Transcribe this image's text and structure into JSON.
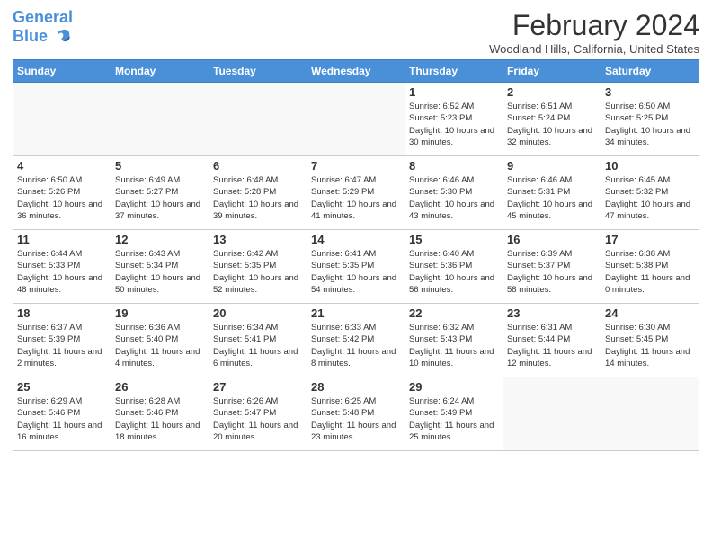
{
  "logo": {
    "general": "General",
    "blue": "Blue"
  },
  "title": "February 2024",
  "location": "Woodland Hills, California, United States",
  "days_of_week": [
    "Sunday",
    "Monday",
    "Tuesday",
    "Wednesday",
    "Thursday",
    "Friday",
    "Saturday"
  ],
  "weeks": [
    [
      {
        "day": "",
        "info": ""
      },
      {
        "day": "",
        "info": ""
      },
      {
        "day": "",
        "info": ""
      },
      {
        "day": "",
        "info": ""
      },
      {
        "day": "1",
        "info": "Sunrise: 6:52 AM\nSunset: 5:23 PM\nDaylight: 10 hours\nand 30 minutes."
      },
      {
        "day": "2",
        "info": "Sunrise: 6:51 AM\nSunset: 5:24 PM\nDaylight: 10 hours\nand 32 minutes."
      },
      {
        "day": "3",
        "info": "Sunrise: 6:50 AM\nSunset: 5:25 PM\nDaylight: 10 hours\nand 34 minutes."
      }
    ],
    [
      {
        "day": "4",
        "info": "Sunrise: 6:50 AM\nSunset: 5:26 PM\nDaylight: 10 hours\nand 36 minutes."
      },
      {
        "day": "5",
        "info": "Sunrise: 6:49 AM\nSunset: 5:27 PM\nDaylight: 10 hours\nand 37 minutes."
      },
      {
        "day": "6",
        "info": "Sunrise: 6:48 AM\nSunset: 5:28 PM\nDaylight: 10 hours\nand 39 minutes."
      },
      {
        "day": "7",
        "info": "Sunrise: 6:47 AM\nSunset: 5:29 PM\nDaylight: 10 hours\nand 41 minutes."
      },
      {
        "day": "8",
        "info": "Sunrise: 6:46 AM\nSunset: 5:30 PM\nDaylight: 10 hours\nand 43 minutes."
      },
      {
        "day": "9",
        "info": "Sunrise: 6:46 AM\nSunset: 5:31 PM\nDaylight: 10 hours\nand 45 minutes."
      },
      {
        "day": "10",
        "info": "Sunrise: 6:45 AM\nSunset: 5:32 PM\nDaylight: 10 hours\nand 47 minutes."
      }
    ],
    [
      {
        "day": "11",
        "info": "Sunrise: 6:44 AM\nSunset: 5:33 PM\nDaylight: 10 hours\nand 48 minutes."
      },
      {
        "day": "12",
        "info": "Sunrise: 6:43 AM\nSunset: 5:34 PM\nDaylight: 10 hours\nand 50 minutes."
      },
      {
        "day": "13",
        "info": "Sunrise: 6:42 AM\nSunset: 5:35 PM\nDaylight: 10 hours\nand 52 minutes."
      },
      {
        "day": "14",
        "info": "Sunrise: 6:41 AM\nSunset: 5:35 PM\nDaylight: 10 hours\nand 54 minutes."
      },
      {
        "day": "15",
        "info": "Sunrise: 6:40 AM\nSunset: 5:36 PM\nDaylight: 10 hours\nand 56 minutes."
      },
      {
        "day": "16",
        "info": "Sunrise: 6:39 AM\nSunset: 5:37 PM\nDaylight: 10 hours\nand 58 minutes."
      },
      {
        "day": "17",
        "info": "Sunrise: 6:38 AM\nSunset: 5:38 PM\nDaylight: 11 hours\nand 0 minutes."
      }
    ],
    [
      {
        "day": "18",
        "info": "Sunrise: 6:37 AM\nSunset: 5:39 PM\nDaylight: 11 hours\nand 2 minutes."
      },
      {
        "day": "19",
        "info": "Sunrise: 6:36 AM\nSunset: 5:40 PM\nDaylight: 11 hours\nand 4 minutes."
      },
      {
        "day": "20",
        "info": "Sunrise: 6:34 AM\nSunset: 5:41 PM\nDaylight: 11 hours\nand 6 minutes."
      },
      {
        "day": "21",
        "info": "Sunrise: 6:33 AM\nSunset: 5:42 PM\nDaylight: 11 hours\nand 8 minutes."
      },
      {
        "day": "22",
        "info": "Sunrise: 6:32 AM\nSunset: 5:43 PM\nDaylight: 11 hours\nand 10 minutes."
      },
      {
        "day": "23",
        "info": "Sunrise: 6:31 AM\nSunset: 5:44 PM\nDaylight: 11 hours\nand 12 minutes."
      },
      {
        "day": "24",
        "info": "Sunrise: 6:30 AM\nSunset: 5:45 PM\nDaylight: 11 hours\nand 14 minutes."
      }
    ],
    [
      {
        "day": "25",
        "info": "Sunrise: 6:29 AM\nSunset: 5:46 PM\nDaylight: 11 hours\nand 16 minutes."
      },
      {
        "day": "26",
        "info": "Sunrise: 6:28 AM\nSunset: 5:46 PM\nDaylight: 11 hours\nand 18 minutes."
      },
      {
        "day": "27",
        "info": "Sunrise: 6:26 AM\nSunset: 5:47 PM\nDaylight: 11 hours\nand 20 minutes."
      },
      {
        "day": "28",
        "info": "Sunrise: 6:25 AM\nSunset: 5:48 PM\nDaylight: 11 hours\nand 23 minutes."
      },
      {
        "day": "29",
        "info": "Sunrise: 6:24 AM\nSunset: 5:49 PM\nDaylight: 11 hours\nand 25 minutes."
      },
      {
        "day": "",
        "info": ""
      },
      {
        "day": "",
        "info": ""
      }
    ]
  ]
}
